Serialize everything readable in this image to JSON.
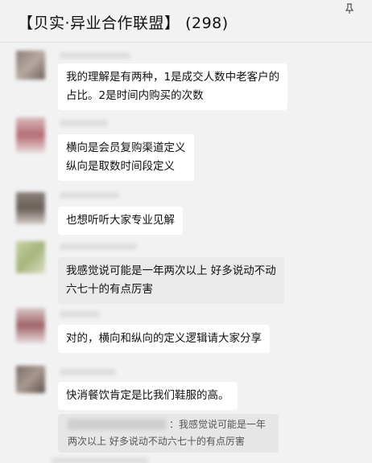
{
  "header": {
    "title": "【贝实·异业合作联盟】 (298)",
    "pin_icon": "pin-icon"
  },
  "messages": [
    {
      "id": 1,
      "lines": [
        "我的理解是有两种，1是成交人数中老客户的",
        "占比。2是时间内购买的次数"
      ],
      "bubble_color": "#ffffff"
    },
    {
      "id": 2,
      "lines": [
        "横向是会员复购渠道定义",
        "纵向是取数时间段定义"
      ],
      "bubble_color": "#ffffff"
    },
    {
      "id": 3,
      "lines": [
        "也想听听大家专业见解"
      ],
      "bubble_color": "#ffffff"
    },
    {
      "id": 4,
      "lines": [
        "我感觉说可能是一年两次以上  好多说动不动",
        "六七十的有点厉害"
      ],
      "bubble_color": "#eaeaea"
    },
    {
      "id": 5,
      "lines": [
        "对的，横向和纵向的定义逻辑请大家分享"
      ],
      "bubble_color": "#ffffff"
    },
    {
      "id": 6,
      "lines": [
        "快消餐饮肯定是比我们鞋服的高。"
      ],
      "bubble_color": "#ffffff"
    }
  ],
  "quote": {
    "text": "：我感觉说可能是一年两次以上  好多说动不动六七十的有点厉害"
  },
  "colors": {
    "background": "#f2f2f2",
    "bubble": "#ffffff",
    "self_bubble": "#eaeaea"
  }
}
